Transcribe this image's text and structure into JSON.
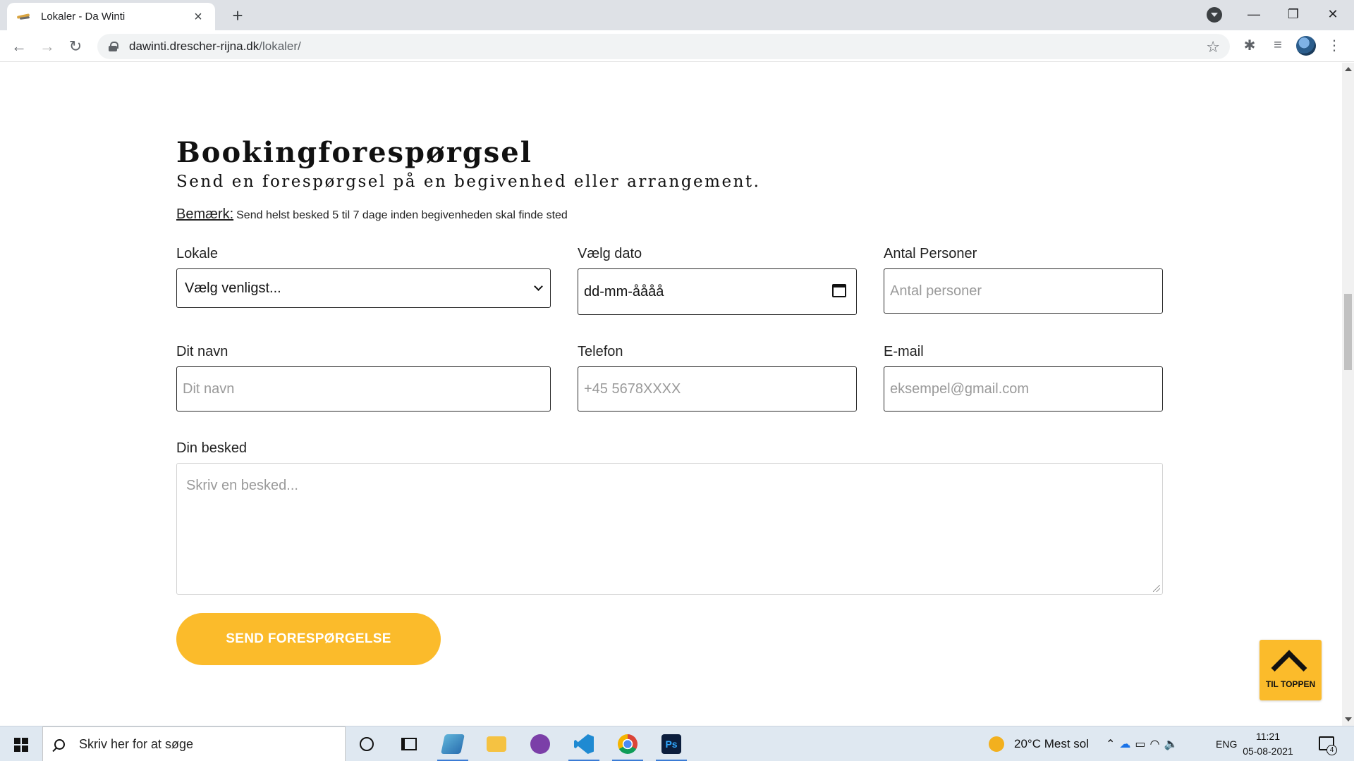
{
  "browser": {
    "tab_title": "Lokaler - Da Winti",
    "tab_close": "×",
    "new_tab": "+",
    "url_host": "dawinti.drescher-rijna.dk",
    "url_path": "/lokaler/",
    "window_controls": {
      "minimize": "—",
      "restore": "❐",
      "close": "✕"
    }
  },
  "page": {
    "heading": "Bookingforespørgsel",
    "subheading": "Send en forespørgsel på en begivenhed eller arrangement.",
    "note_label": "Bemærk:",
    "note_text": "Send helst besked 5 til 7 dage inden begivenheden skal finde sted",
    "form": {
      "lokale_label": "Lokale",
      "lokale_value": "Vælg venligst...",
      "dato_label": "Vælg dato",
      "dato_value": "dd-mm-åååå",
      "antal_label": "Antal Personer",
      "antal_placeholder": "Antal personer",
      "navn_label": "Dit navn",
      "navn_placeholder": "Dit navn",
      "telefon_label": "Telefon",
      "telefon_placeholder": "+45 5678XXXX",
      "email_label": "E-mail",
      "email_placeholder": "eksempel@gmail.com",
      "besked_label": "Din besked",
      "besked_placeholder": "Skriv en besked...",
      "submit_label": "SEND FORESPØRGELSE"
    },
    "to_top_label": "TIL TOPPEN",
    "accent_color": "#fbbb2b"
  },
  "taskbar": {
    "search_placeholder": "Skriv her for at søge",
    "apps": [
      "cortana",
      "task-view",
      "sticky-app",
      "file-explorer",
      "github-desktop",
      "vs-code",
      "chrome",
      "photoshop"
    ],
    "photoshop_label": "Ps",
    "weather": "20°C  Mest sol",
    "language": "ENG",
    "time": "11:21",
    "date": "05-08-2021",
    "notification_count": "4"
  }
}
